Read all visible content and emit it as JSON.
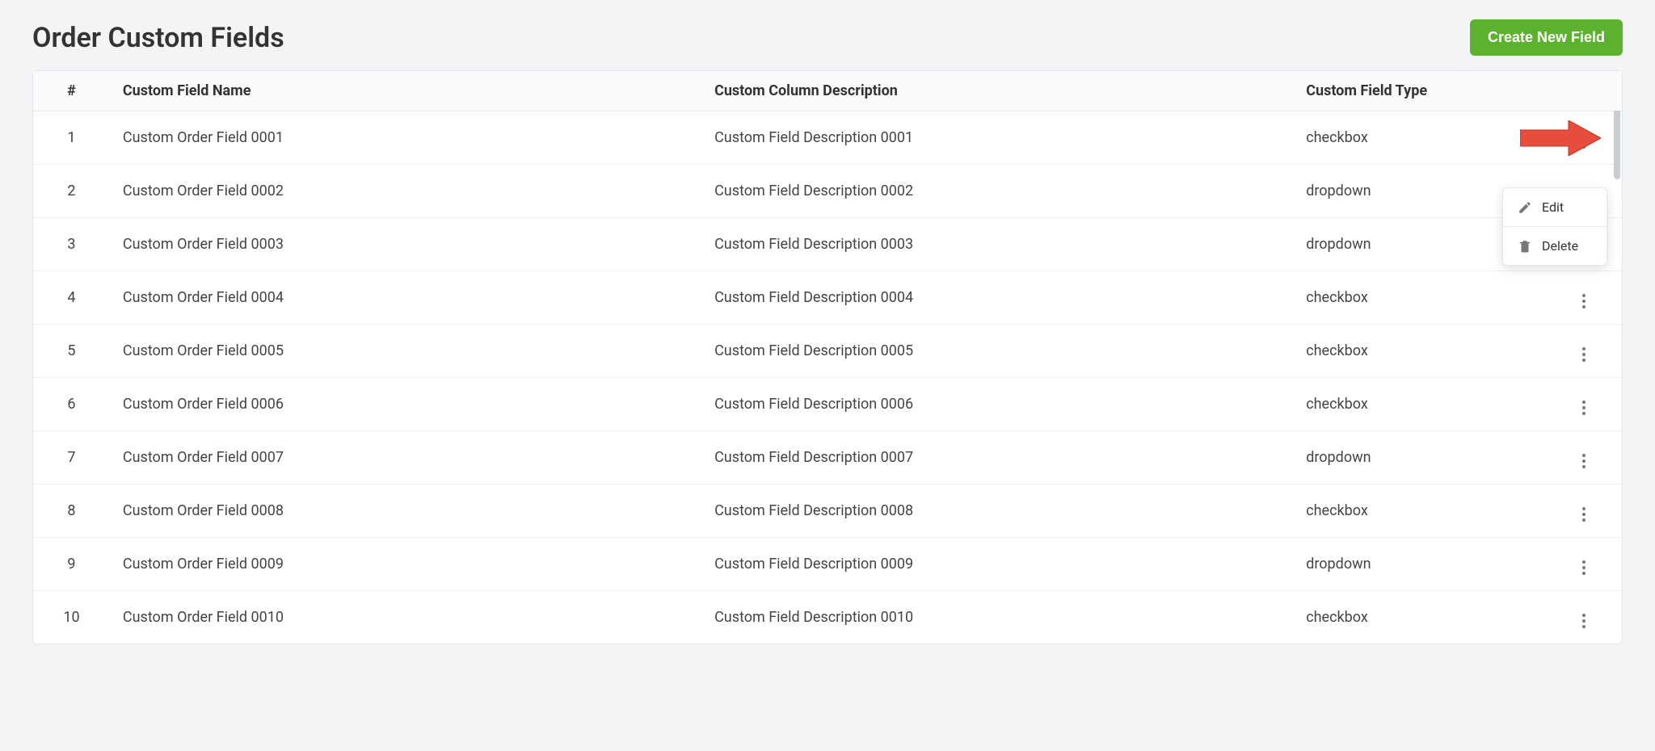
{
  "header": {
    "title": "Order Custom Fields",
    "create_label": "Create New Field"
  },
  "table": {
    "columns": {
      "num": "#",
      "name": "Custom Field Name",
      "desc": "Custom Column Description",
      "type": "Custom Field Type"
    },
    "rows": [
      {
        "num": "1",
        "name": "Custom Order Field 0001",
        "desc": "Custom Field Description 0001",
        "type": "checkbox"
      },
      {
        "num": "2",
        "name": "Custom Order Field 0002",
        "desc": "Custom Field Description 0002",
        "type": "dropdown"
      },
      {
        "num": "3",
        "name": "Custom Order Field 0003",
        "desc": "Custom Field Description 0003",
        "type": "dropdown"
      },
      {
        "num": "4",
        "name": "Custom Order Field 0004",
        "desc": "Custom Field Description 0004",
        "type": "checkbox"
      },
      {
        "num": "5",
        "name": "Custom Order Field 0005",
        "desc": "Custom Field Description 0005",
        "type": "checkbox"
      },
      {
        "num": "6",
        "name": "Custom Order Field 0006",
        "desc": "Custom Field Description 0006",
        "type": "checkbox"
      },
      {
        "num": "7",
        "name": "Custom Order Field 0007",
        "desc": "Custom Field Description 0007",
        "type": "dropdown"
      },
      {
        "num": "8",
        "name": "Custom Order Field 0008",
        "desc": "Custom Field Description 0008",
        "type": "checkbox"
      },
      {
        "num": "9",
        "name": "Custom Order Field 0009",
        "desc": "Custom Field Description 0009",
        "type": "dropdown"
      },
      {
        "num": "10",
        "name": "Custom Order Field 0010",
        "desc": "Custom Field Description 0010",
        "type": "checkbox"
      }
    ]
  },
  "menu": {
    "edit": "Edit",
    "delete": "Delete"
  },
  "colors": {
    "primary_button": "#5cb12f",
    "arrow": "#e74c3c"
  }
}
